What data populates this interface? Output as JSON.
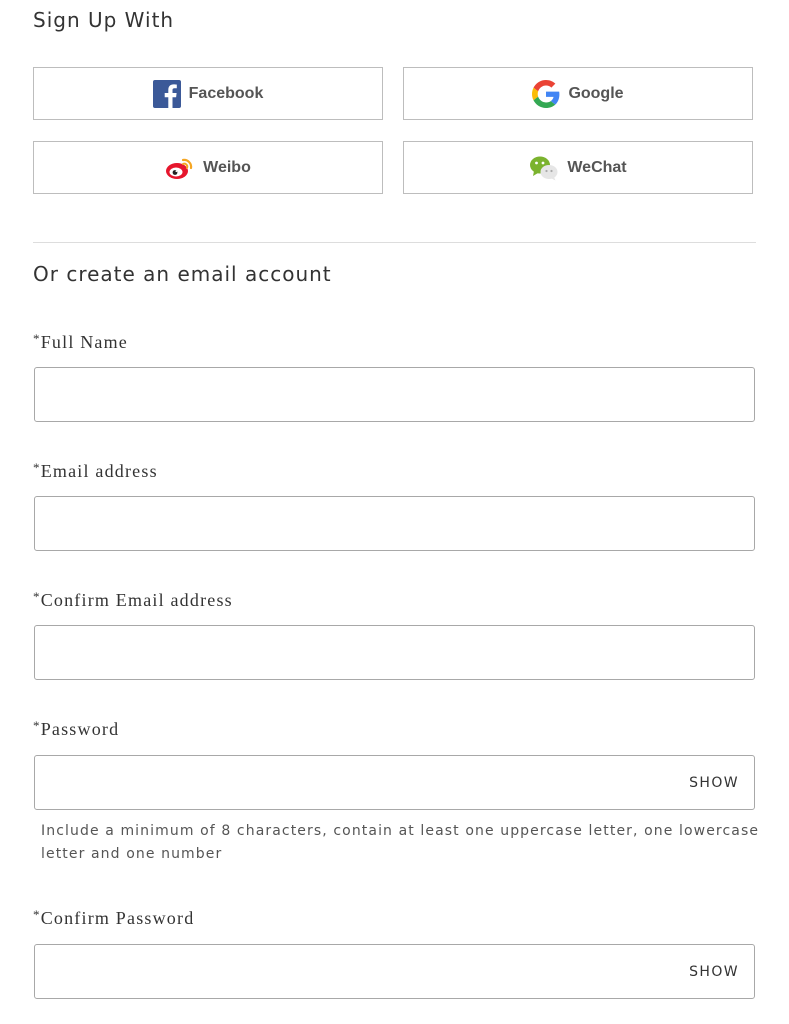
{
  "signup": {
    "title": "Sign Up With",
    "providers": {
      "facebook": {
        "label": "Facebook",
        "icon": "facebook-icon",
        "color": "#3b5998"
      },
      "google": {
        "label": "Google",
        "icon": "google-icon"
      },
      "weibo": {
        "label": "Weibo",
        "icon": "weibo-icon",
        "color": "#e6162d"
      },
      "wechat": {
        "label": "WeChat",
        "icon": "wechat-icon",
        "color": "#7bb32e"
      }
    }
  },
  "email_section": {
    "title": "Or create an email account"
  },
  "form": {
    "required_marker": "*",
    "full_name": {
      "label": "Full Name",
      "value": ""
    },
    "email": {
      "label": "Email address",
      "value": ""
    },
    "confirm_email": {
      "label": "Confirm Email address",
      "value": ""
    },
    "password": {
      "label": "Password",
      "value": "",
      "toggle": "SHOW",
      "hint": "Include a minimum of 8 characters, contain at least one uppercase letter, one lowercase letter and one number"
    },
    "confirm_password": {
      "label": "Confirm Password",
      "value": "",
      "toggle": "SHOW"
    }
  }
}
